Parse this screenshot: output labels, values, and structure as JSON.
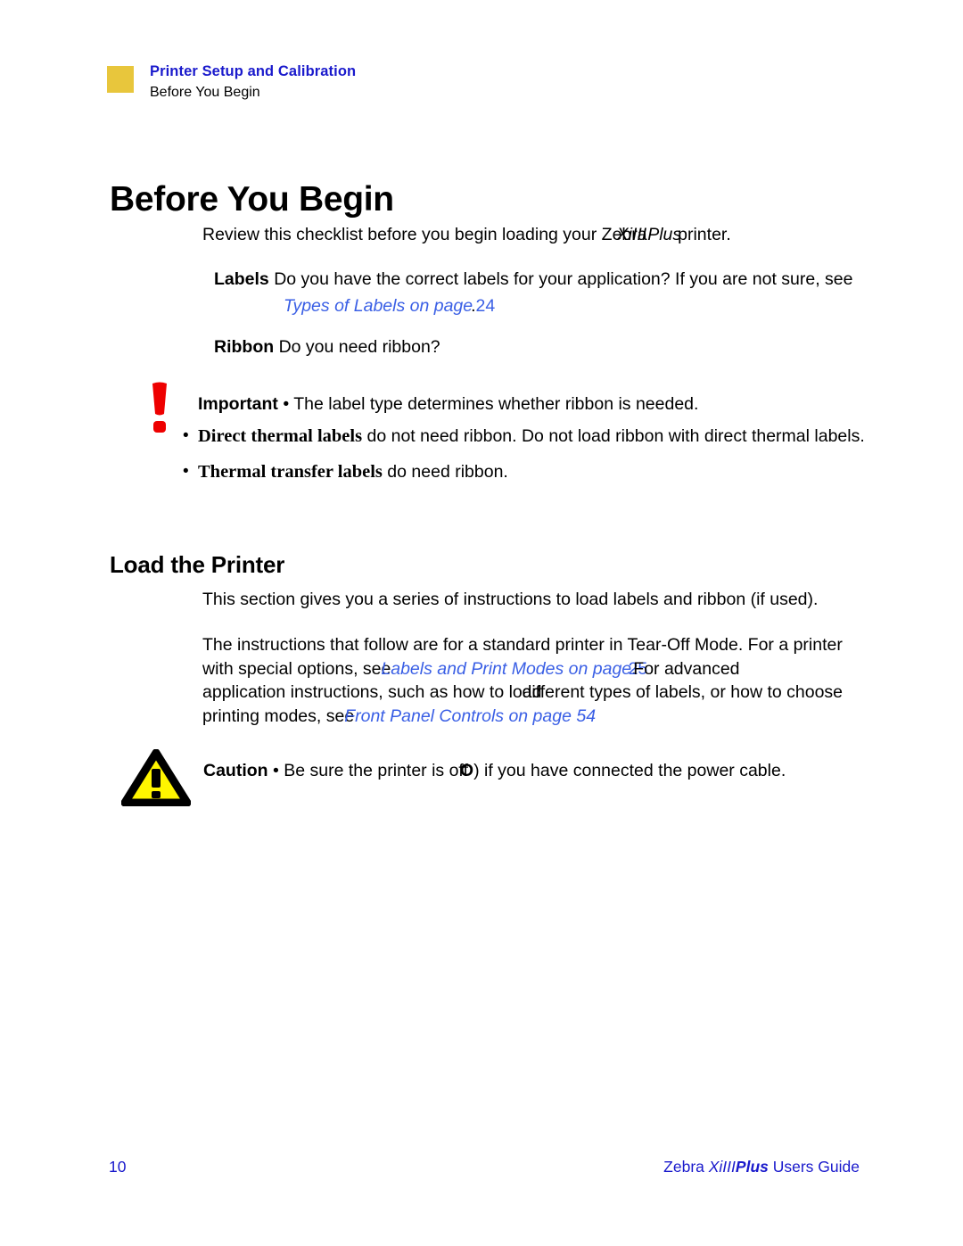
{
  "header": {
    "chapter": "Printer Setup and Calibration",
    "section": "Before You Begin",
    "swatch_color": "#E8C63C",
    "chapter_color": "#1A1ACC"
  },
  "headings": {
    "h1": "Before You Begin",
    "h2": "Load the Printer"
  },
  "lead_paragraph": {
    "before": "Review this checklist before you begin loading your Zebra",
    "model": "XiIII",
    "plus": "Plus",
    "after": "printer."
  },
  "checklist": {
    "labels": {
      "term": "Labels",
      "text": "Do you have the correct labels for your application? If you are not sure, see",
      "link_text": "Types of Labels on page",
      "link_sep": ".",
      "link_page": "24",
      "link_color": "#3A5FE5"
    },
    "ribbon": {
      "term": "Ribbon",
      "text": "Do you need ribbon?"
    }
  },
  "important_note": {
    "icon": "exclamation-mark-icon",
    "icon_color": "#EE0000",
    "label": "Important",
    "separator": "•",
    "text": "The label type determines whether ribbon is needed.",
    "bullets": [
      {
        "marker": "•",
        "bold": "Direct thermal labels",
        "rest": "do not need ribbon. Do not load ribbon with direct thermal",
        "wrap": "labels."
      },
      {
        "marker": "•",
        "bold": "Thermal transfer labels",
        "rest": "do need ribbon.",
        "wrap": ""
      }
    ]
  },
  "load_section": {
    "paragraph_1": "This section gives you a series of instructions to load labels and ribbon (if used).",
    "paragraph_2": {
      "line1": "The instructions that follow are for a standard printer in Tear-Off Mode. For a printer",
      "line2_a": "with special options, see",
      "line2_link": "Labels and Print Modes on page",
      "line2_link_sep": ".",
      "line2_link_page": "25",
      "line2_b": "For advanced",
      "line3_a": "application instructions, such as how to load",
      "line3_b": "different types of labels, or how to choose",
      "line4_a": "printing modes, see",
      "line4_link": "Front Panel Controls on page 54"
    }
  },
  "caution_note": {
    "icon": "warning-triangle-icon",
    "icon_fill": "#FFF500",
    "icon_stroke": "#000000",
    "label": "Caution",
    "separator": "•",
    "text_a": "Be sure the printer is off",
    "text_symbol": "O",
    "text_paren": ")",
    "text_b": "if you have connected the power cable."
  },
  "footer": {
    "page_number": "10",
    "guide_prefix": "Zebra ",
    "guide_model": "XiIII",
    "guide_plus": "Plus",
    "guide_suffix": " Users Guide",
    "color": "#1A1ACC"
  }
}
